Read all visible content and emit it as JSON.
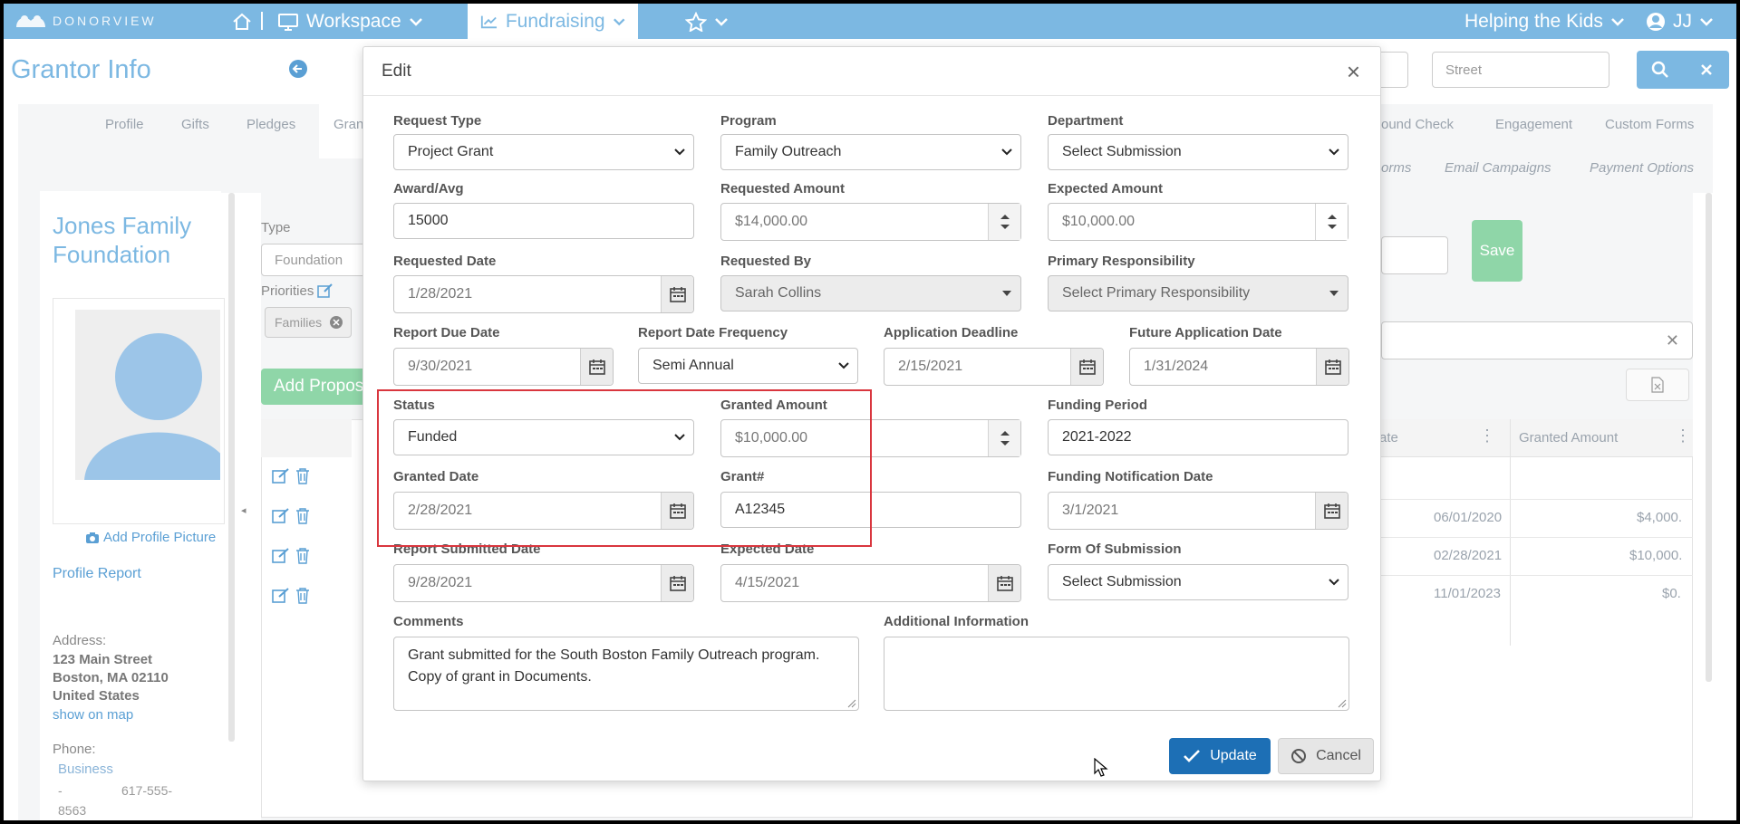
{
  "nav": {
    "brand": "DONORVIEW",
    "workspace": "Workspace",
    "fundraising": "Fundraising",
    "org_selector": "Helping the Kids",
    "user_initials": "JJ"
  },
  "page": {
    "title": "Grantor Info",
    "street_placeholder": "Street",
    "tabs_row1": [
      "Profile",
      "Gifts",
      "Pledges",
      "Gran",
      "ound Check",
      "Engagement",
      "Custom Forms"
    ],
    "tabs_row2": [
      "orms",
      "Email Campaigns",
      "Payment Options"
    ],
    "save_label": "Save"
  },
  "profile": {
    "name": "Jones Family Foundation",
    "add_picture": "Add Profile Picture",
    "report_link": "Profile Report",
    "address_label": "Address:",
    "address_lines": [
      "123 Main Street",
      "Boston, MA 02110",
      "United States"
    ],
    "map_link": "show on map",
    "phone_label": "Phone:",
    "phone_type": "Business",
    "phone_dash": "-",
    "phone_number": "617-555-",
    "phone_suffix": "8563"
  },
  "background_panel": {
    "type_label": "Type",
    "type_value": "Foundation",
    "priorities_label": "Priorities",
    "priority_chip": "Families",
    "add_proposal": "Add Propos",
    "grid_headers": [
      "ate",
      "Granted Amount"
    ],
    "grid_rows": [
      {
        "date": "06/01/2020",
        "amount": "$4,000."
      },
      {
        "date": "02/28/2021",
        "amount": "$10,000."
      },
      {
        "date": "11/01/2023",
        "amount": "$0."
      }
    ]
  },
  "modal": {
    "title": "Edit",
    "fields": {
      "request_type": {
        "label": "Request Type",
        "value": "Project Grant"
      },
      "program": {
        "label": "Program",
        "value": "Family Outreach"
      },
      "department": {
        "label": "Department",
        "value": "Select Submission"
      },
      "award_avg": {
        "label": "Award/Avg",
        "value": "15000"
      },
      "requested_amount": {
        "label": "Requested Amount",
        "value": "$14,000.00"
      },
      "expected_amount": {
        "label": "Expected Amount",
        "value": "$10,000.00"
      },
      "requested_date": {
        "label": "Requested Date",
        "value": "1/28/2021"
      },
      "requested_by": {
        "label": "Requested By",
        "value": "Sarah Collins"
      },
      "primary_responsibility": {
        "label": "Primary Responsibility",
        "value": "Select Primary Responsibility"
      },
      "report_due_date": {
        "label": "Report Due Date",
        "value": "9/30/2021"
      },
      "report_date_frequency": {
        "label": "Report Date Frequency",
        "value": "Semi Annual"
      },
      "application_deadline": {
        "label": "Application Deadline",
        "value": "2/15/2021"
      },
      "future_application_date": {
        "label": "Future Application Date",
        "value": "1/31/2024"
      },
      "status": {
        "label": "Status",
        "value": "Funded"
      },
      "granted_amount": {
        "label": "Granted Amount",
        "value": "$10,000.00"
      },
      "funding_period": {
        "label": "Funding Period",
        "value": "2021-2022"
      },
      "granted_date": {
        "label": "Granted Date",
        "value": "2/28/2021"
      },
      "grant_number": {
        "label": "Grant#",
        "value": "A12345"
      },
      "funding_notification_date": {
        "label": "Funding Notification Date",
        "value": "3/1/2021"
      },
      "report_submitted_date": {
        "label": "Report Submitted Date",
        "value": "9/28/2021"
      },
      "expected_date": {
        "label": "Expected Date",
        "value": "4/15/2021"
      },
      "form_of_submission": {
        "label": "Form Of Submission",
        "value": "Select Submission"
      },
      "comments": {
        "label": "Comments",
        "value": "Grant submitted for the South Boston Family Outreach program. Copy of grant in Documents."
      },
      "additional_information": {
        "label": "Additional Information",
        "value": ""
      }
    },
    "update_label": "Update",
    "cancel_label": "Cancel"
  },
  "colors": {
    "nav": "#7cb8e2",
    "primary_button": "#1d6fb5",
    "highlight_box": "#d9363e",
    "save_button": "#8fd6a8"
  }
}
